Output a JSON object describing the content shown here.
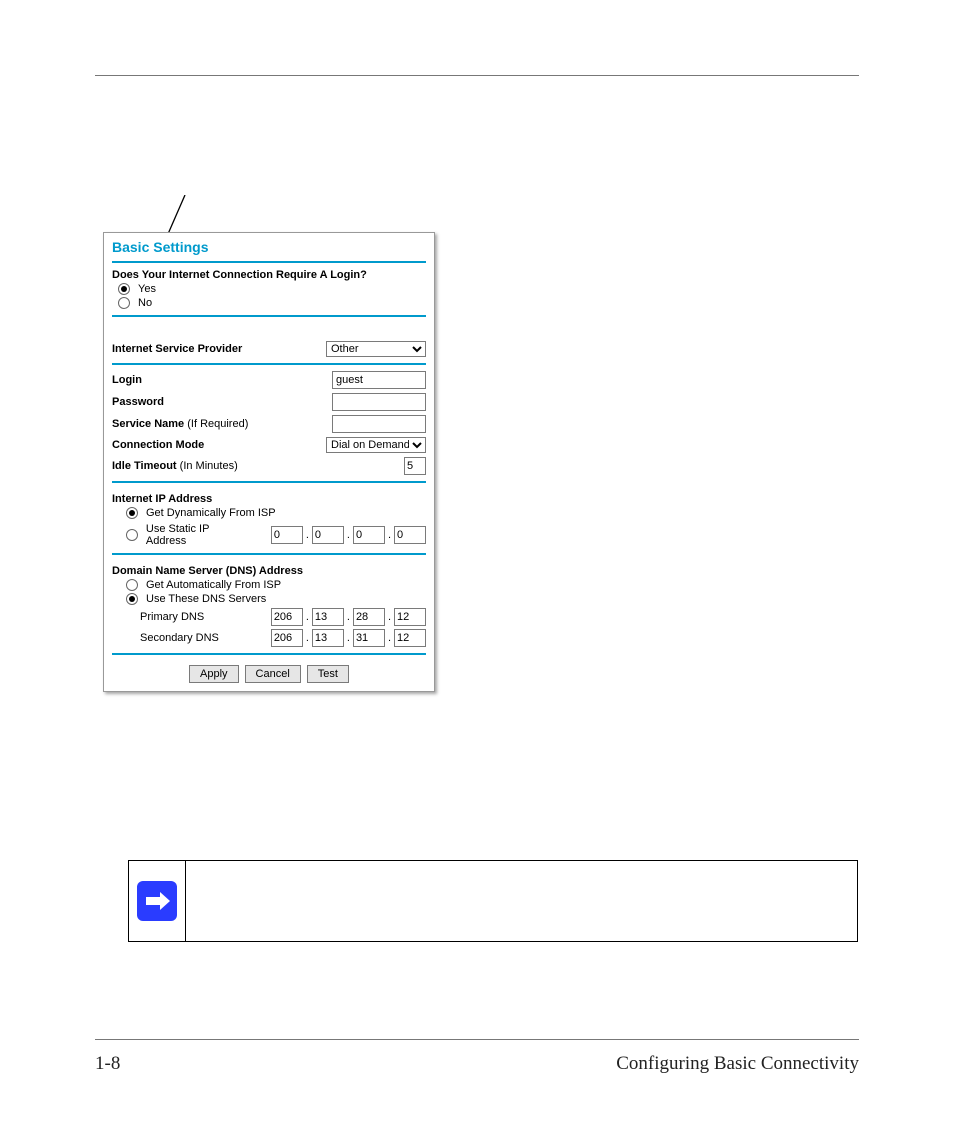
{
  "footer": {
    "page_number": "1-8",
    "section_title": "Configuring Basic Connectivity"
  },
  "panel": {
    "title": "Basic Settings",
    "login_question": "Does Your Internet Connection Require A Login?",
    "yes_label": "Yes",
    "no_label": "No",
    "isp_label": "Internet Service Provider",
    "isp_value": "Other",
    "login_label": "Login",
    "login_value": "guest",
    "password_label": "Password",
    "password_value": "",
    "service_name_label": "Service Name (If Required)",
    "service_name_value": "",
    "connection_mode_label": "Connection Mode",
    "connection_mode_value": "Dial on Demand",
    "idle_timeout_label": "Idle Timeout (In Minutes)",
    "idle_timeout_value": "5",
    "ip_section_header": "Internet IP Address",
    "ip_dynamic_label": "Get Dynamically From ISP",
    "ip_static_label": "Use Static IP Address",
    "static_ip": [
      "0",
      "0",
      "0",
      "0"
    ],
    "dns_section_header": "Domain Name Server (DNS) Address",
    "dns_auto_label": "Get Automatically From ISP",
    "dns_manual_label": "Use These DNS Servers",
    "primary_dns_label": "Primary DNS",
    "primary_dns": [
      "206",
      "13",
      "28",
      "12"
    ],
    "secondary_dns_label": "Secondary DNS",
    "secondary_dns": [
      "206",
      "13",
      "31",
      "12"
    ],
    "apply_label": "Apply",
    "cancel_label": "Cancel",
    "test_label": "Test"
  }
}
